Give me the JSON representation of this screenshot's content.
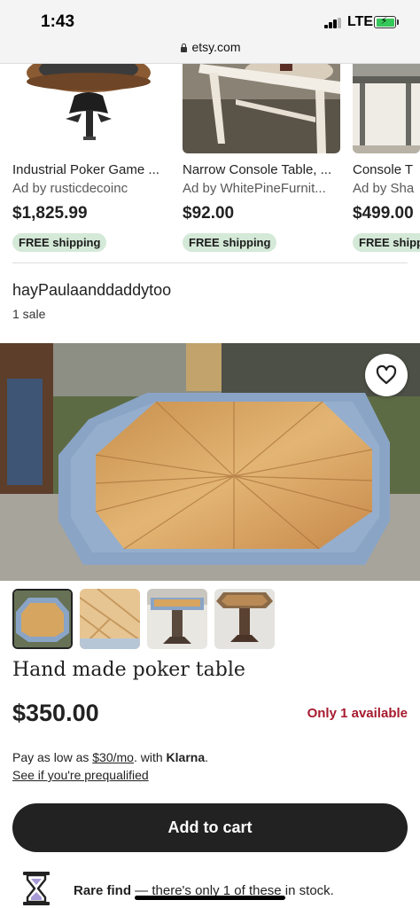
{
  "status_bar": {
    "time": "1:43",
    "network": "LTE",
    "url": "etsy.com"
  },
  "ads": [
    {
      "title": "Industrial Poker Game ...",
      "by": "Ad by rusticdecoinc",
      "price": "$1,825.99",
      "shipping": "FREE shipping"
    },
    {
      "title": "Narrow Console Table, ...",
      "by": "Ad by WhitePineFurnit...",
      "price": "$92.00",
      "shipping": "FREE shipping"
    },
    {
      "title": "Console T",
      "by": "Ad by Sha",
      "price": "$499.00",
      "shipping": "FREE shipp"
    }
  ],
  "shop": {
    "name": "hayPaulaanddaddytoo",
    "sales": "1 sale"
  },
  "listing": {
    "title": "Hand made poker table",
    "price": "$350.00",
    "availability": "Only 1 available"
  },
  "klarna": {
    "prefix": "Pay as low as ",
    "amount": "$30/mo",
    "middle": ". with ",
    "brand": "Klarna",
    "suffix": ".",
    "prequal_link": "See if you're prequalified"
  },
  "cart": {
    "button_label": "Add to cart"
  },
  "rare_find": {
    "label": "Rare find",
    "text": " — there's only 1 of these in stock."
  },
  "icons": {
    "favorite": "heart-outline-icon",
    "rare_find": "hourglass-icon",
    "lock": "lock-icon"
  },
  "colors": {
    "availability": "#a61a2e",
    "shipping_badge": "#d4e9d7",
    "cart_button": "#222222"
  }
}
